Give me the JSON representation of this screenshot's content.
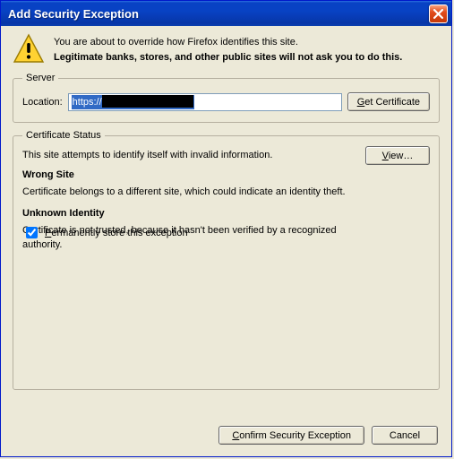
{
  "window": {
    "title": "Add Security Exception"
  },
  "intro": {
    "line1": "You are about to override how Firefox identifies this site.",
    "line2": "Legitimate banks, stores, and other public sites will not ask you to do this."
  },
  "server": {
    "legend": "Server",
    "location_label": "Location:",
    "location_value_visible": "https://",
    "get_cert_label": "Get Certificate",
    "get_cert_accel": "G"
  },
  "status": {
    "legend": "Certificate Status",
    "desc": "This site attempts to identify itself with invalid information.",
    "view_label": "View…",
    "view_accel": "V",
    "sections": [
      {
        "heading": "Wrong Site",
        "body": "Certificate belongs to a different site, which could indicate an identity theft."
      },
      {
        "heading": "Unknown Identity",
        "body": "Certificate is not trusted, because it hasn't been verified by a recognized authority."
      }
    ]
  },
  "permanent": {
    "checked": true,
    "label": "Permanently store this exception",
    "accel": "P"
  },
  "buttons": {
    "confirm": "Confirm Security Exception",
    "confirm_accel": "C",
    "cancel": "Cancel"
  }
}
